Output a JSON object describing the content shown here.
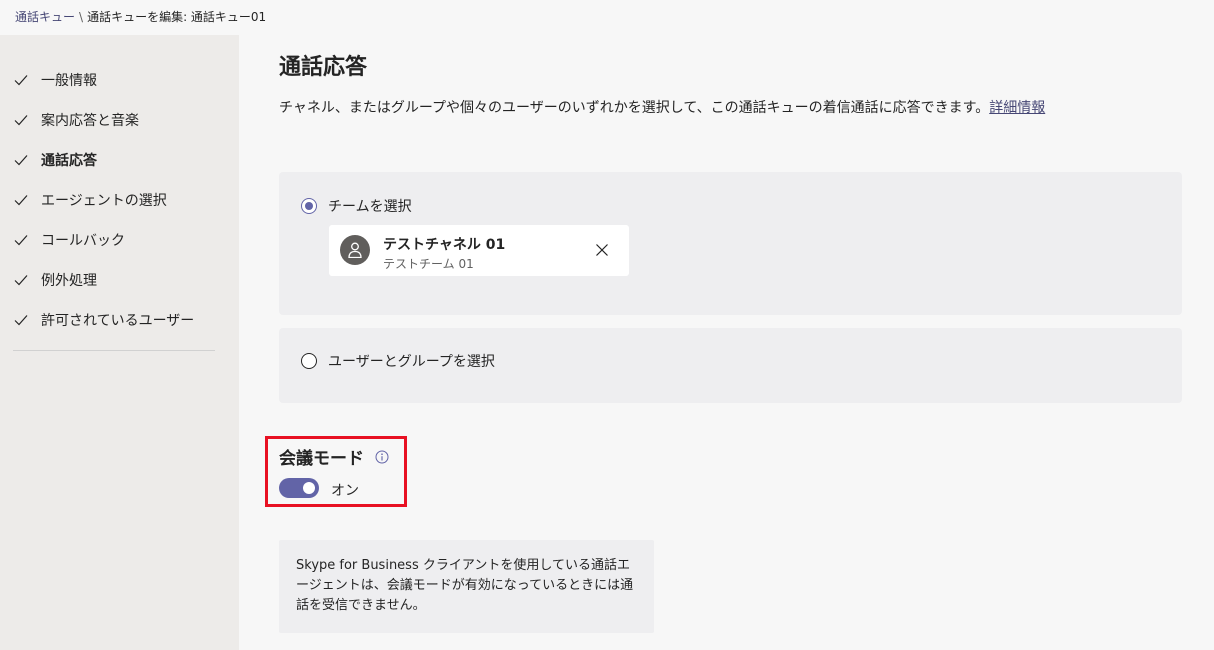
{
  "breadcrumb": {
    "parent": "通話キュー",
    "separator": "\\",
    "current": "通話キューを編集: 通話キュー01"
  },
  "sidebar": {
    "items": [
      {
        "label": "一般情報",
        "state": "done"
      },
      {
        "label": "案内応答と音楽",
        "state": "done"
      },
      {
        "label": "通話応答",
        "state": "current"
      },
      {
        "label": "エージェントの選択",
        "state": "done"
      },
      {
        "label": "コールバック",
        "state": "done"
      },
      {
        "label": "例外処理",
        "state": "done"
      },
      {
        "label": "許可されているユーザー",
        "state": "done"
      }
    ]
  },
  "main": {
    "title": "通話応答",
    "description": "チャネル、またはグループや個々のユーザーのいずれかを選択して、この通話キューの着信通話に応答できます。",
    "learn_more": "詳細情報",
    "options": {
      "team": {
        "label": "チームを選択",
        "selected": true
      },
      "users": {
        "label": "ユーザーとグループを選択",
        "selected": false
      }
    },
    "selected_team": {
      "channel": "テストチャネル 01",
      "team": "テストチーム 01"
    },
    "conference_mode": {
      "title": "会議モード",
      "toggle_state": "オン",
      "enabled": true
    },
    "note": "Skype for Business クライアントを使用している通話エージェントは、会議モードが有効になっているときには通話を受信できません。"
  },
  "colors": {
    "accent": "#6264a7",
    "highlight_border": "#e81123",
    "sidebar_bg": "#edebe9",
    "card_bg": "#eeeef0"
  }
}
